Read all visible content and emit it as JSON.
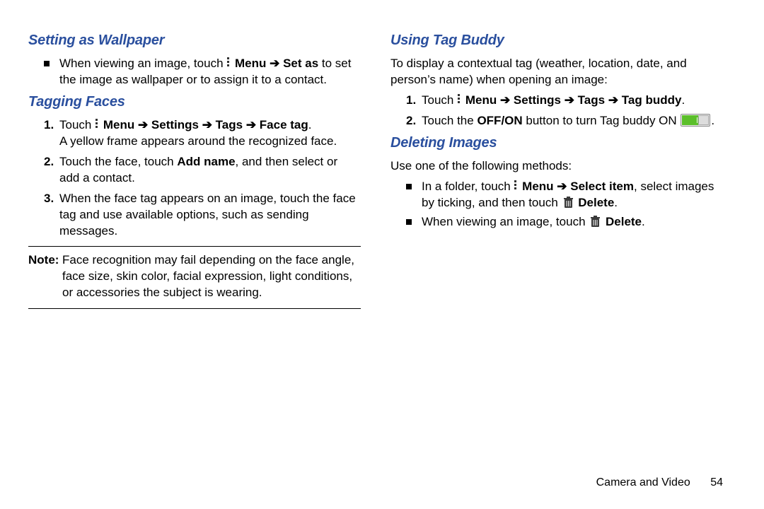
{
  "left": {
    "h_wallpaper": "Setting as Wallpaper",
    "wallpaper_bullet_pre": "When viewing an image, touch ",
    "wallpaper_bullet_menu": "Menu ",
    "wallpaper_bullet_arrow": "➔ ",
    "wallpaper_bullet_setas": "Set as ",
    "wallpaper_bullet_post": "to set the image as wallpaper or to assign it to a contact.",
    "h_tagging": "Tagging Faces",
    "tag_s1_pre": "Touch ",
    "tag_s1_menu": "Menu ",
    "tag_s1_ar1": "➔ ",
    "tag_s1_settings": "Settings ",
    "tag_s1_ar2": "➔ ",
    "tag_s1_tags": "Tags ",
    "tag_s1_ar3": "➔ ",
    "tag_s1_facetag": "Face tag",
    "tag_s1_dot": ".",
    "tag_s1_line2": "A yellow frame appears around the recognized face.",
    "tag_s2_pre": "Touch the face, touch ",
    "tag_s2_add": "Add name",
    "tag_s2_post": ", and then select or add a contact.",
    "tag_s3": "When the face tag appears on an image, touch the face tag and use available options, such as sending messages.",
    "note_label": "Note:",
    "note_text": "Face recognition may fail depending on the face angle, face size, skin color, facial expression, light conditions, or accessories the subject is wearing."
  },
  "right": {
    "h_tagbuddy": "Using Tag Buddy",
    "tb_intro": "To display a contextual tag (weather, location, date, and person’s name) when opening an image:",
    "tb_s1_pre": "Touch ",
    "tb_s1_menu": "Menu ",
    "tb_s1_ar1": "➔ ",
    "tb_s1_settings": "Settings ",
    "tb_s1_ar2": "➔ ",
    "tb_s1_tags": "Tags ",
    "tb_s1_ar3": "➔ ",
    "tb_s1_tb": "Tag buddy",
    "tb_s1_dot": ".",
    "tb_s2_pre": "Touch the ",
    "tb_s2_offon": "OFF/ON",
    "tb_s2_mid": " button to turn Tag buddy ON ",
    "tb_s2_dot": ".",
    "h_delete": "Deleting Images",
    "del_intro": "Use one of the following methods:",
    "del_b1_pre": "In a folder, touch ",
    "del_b1_menu": "Menu ",
    "del_b1_ar": "➔ ",
    "del_b1_select": "Select item",
    "del_b1_mid": ", select images by ticking, and then touch ",
    "del_b1_delete": "Delete",
    "del_b1_dot": ".",
    "del_b2_pre": "When viewing an image, touch ",
    "del_b2_delete": "Delete",
    "del_b2_dot": "."
  },
  "footer": {
    "section": "Camera and Video",
    "page": "54"
  }
}
